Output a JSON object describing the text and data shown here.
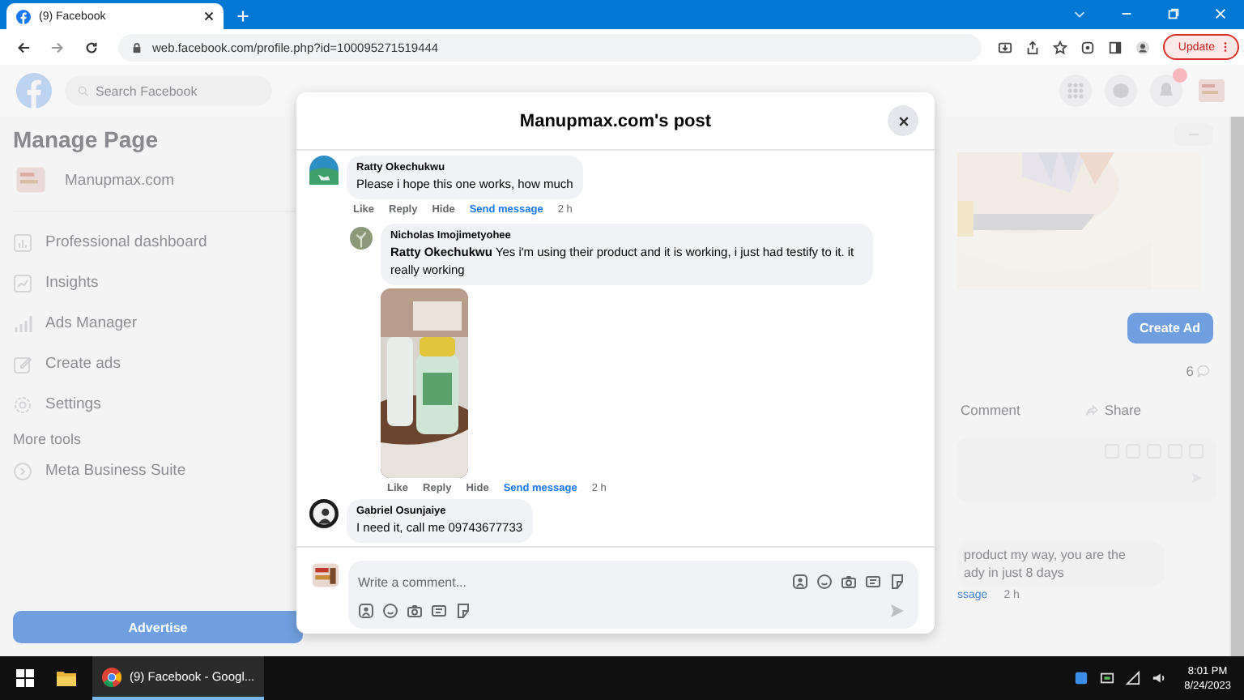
{
  "browser": {
    "tab": {
      "title": "(9) Facebook"
    },
    "address": "web.facebook.com/profile.php?id=100095271519444",
    "update_button": "Update"
  },
  "facebook_header": {
    "search_placeholder": "Search Facebook"
  },
  "sidebar": {
    "title": "Manage Page",
    "page_name": "Manupmax.com",
    "items": [
      {
        "label": "Professional dashboard",
        "kind": "dashboard"
      },
      {
        "label": "Insights",
        "kind": "insights"
      },
      {
        "label": "Ads Manager",
        "kind": "ads"
      },
      {
        "label": "Create ads",
        "kind": "create"
      },
      {
        "label": "Settings",
        "kind": "settings"
      }
    ],
    "section": "More tools",
    "tool": "Meta Business Suite",
    "advertise_button": "Advertise"
  },
  "right_panel": {
    "create_ad_button": "Create Ad",
    "comment_count": "6",
    "actions": [
      "Comment",
      "Share"
    ],
    "reply_lines": [
      "product my way, you are the",
      "ady in just 8 days"
    ],
    "reply_link": "ssage",
    "reply_time": "2 h"
  },
  "modal": {
    "title": "Manupmax.com's post",
    "comments": [
      {
        "author": "Ratty Okechukwu",
        "text": "Please i hope this one works, how much",
        "actions": [
          "Like",
          "Reply",
          "Hide"
        ],
        "link": "Send message",
        "time": "2 h",
        "children": [
          {
            "author": "Nicholas Imojimetyohee",
            "text": "**Ratty Okechukwu** Yes i'm using their product and it is working, i just had testify to it. it really working",
            "has_image": true,
            "actions": [
              "Like",
              "Reply",
              "Hide"
            ],
            "link": "Send message",
            "time": "2 h"
          }
        ]
      },
      {
        "author": "Gabriel Osunjaiye",
        "text": "I need it, call me 09743677733"
      }
    ],
    "composer": {
      "placeholder": "Write a comment..."
    }
  },
  "taskbar": {
    "app": "(9) Facebook - Googl...",
    "time": "8:01 PM",
    "date": "8/24/2023"
  }
}
